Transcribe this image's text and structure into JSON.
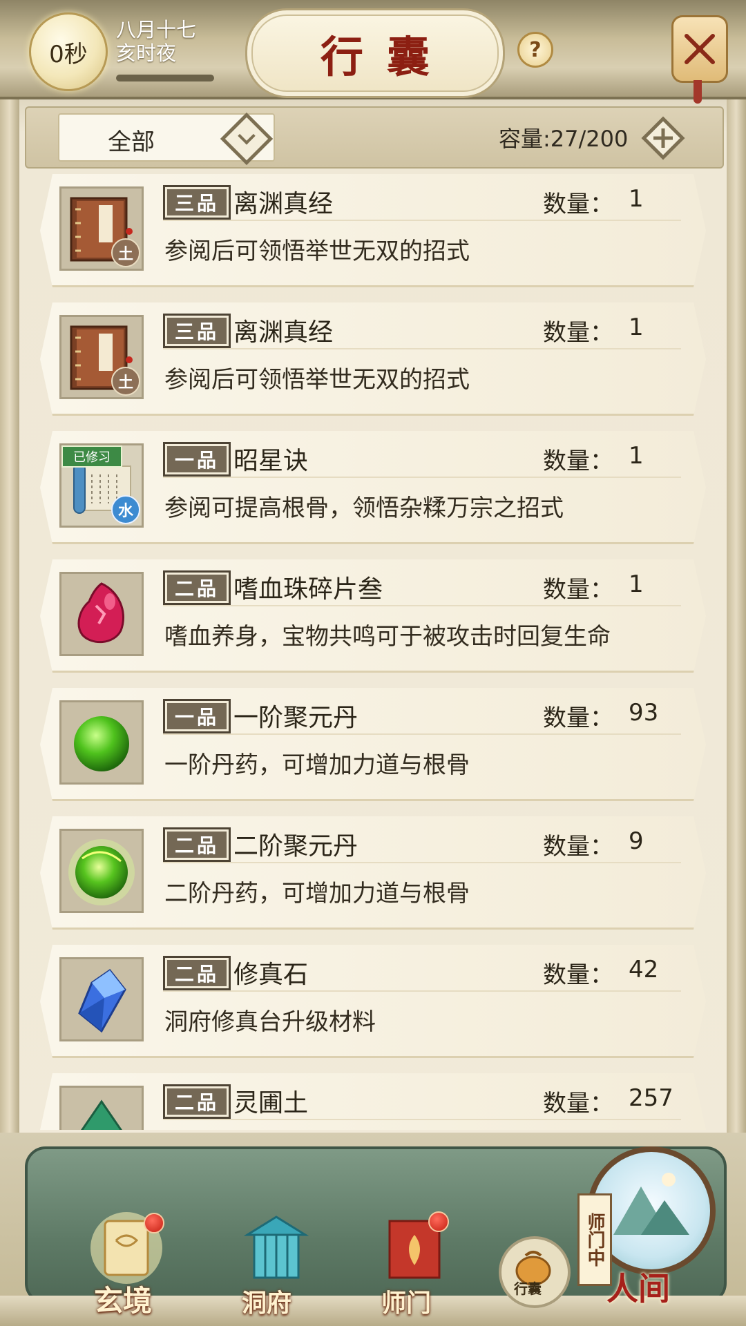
{
  "header": {
    "timer": "0秒",
    "date_line1": "八月十七",
    "date_line2": "亥时夜",
    "title": "行囊",
    "help_glyph": "?"
  },
  "filter": {
    "selected": "全部",
    "capacity": "容量:27/200"
  },
  "items": [
    {
      "grade": "三品",
      "name": "离渊真经",
      "qty_label": "数量：",
      "qty": "1",
      "desc": "参阅后可领悟举世无双的招式",
      "icon": "scripture-book-icon",
      "element": "土"
    },
    {
      "grade": "三品",
      "name": "离渊真经",
      "qty_label": "数量：",
      "qty": "1",
      "desc": "参阅后可领悟举世无双的招式",
      "icon": "scripture-book-icon",
      "element": "土"
    },
    {
      "grade": "一品",
      "name": "昭星诀",
      "qty_label": "数量：",
      "qty": "1",
      "desc": "参阅可提高根骨，领悟杂糅万宗之招式",
      "icon": "scroll-icon",
      "element": "水",
      "badge": "已修习"
    },
    {
      "grade": "二品",
      "name": "嗜血珠碎片叁",
      "qty_label": "数量：",
      "qty": "1",
      "desc": "嗜血养身，宝物共鸣可于被攻击时回复生命",
      "icon": "blood-shard-icon"
    },
    {
      "grade": "一品",
      "name": "一阶聚元丹",
      "qty_label": "数量：",
      "qty": "93",
      "desc": "一阶丹药，可增加力道与根骨",
      "icon": "green-pill-icon"
    },
    {
      "grade": "二品",
      "name": "二阶聚元丹",
      "qty_label": "数量：",
      "qty": "9",
      "desc": "二阶丹药，可增加力道与根骨",
      "icon": "glowing-pill-icon"
    },
    {
      "grade": "二品",
      "name": "修真石",
      "qty_label": "数量：",
      "qty": "42",
      "desc": "洞府修真台升级材料",
      "icon": "crystal-icon"
    },
    {
      "grade": "二品",
      "name": "灵圃土",
      "qty_label": "数量：",
      "qty": "257",
      "desc": "",
      "icon": "soil-icon"
    }
  ],
  "nav": {
    "xuanjing": "玄境",
    "dongfu": "洞府",
    "shimen": "师门",
    "xingnang": "行囊",
    "renjian": "人间",
    "status_banner": "师门中"
  },
  "colors": {
    "title_red": "#8c1f12",
    "grade_plate": "#746855",
    "nav_green": "#5e7a66"
  }
}
